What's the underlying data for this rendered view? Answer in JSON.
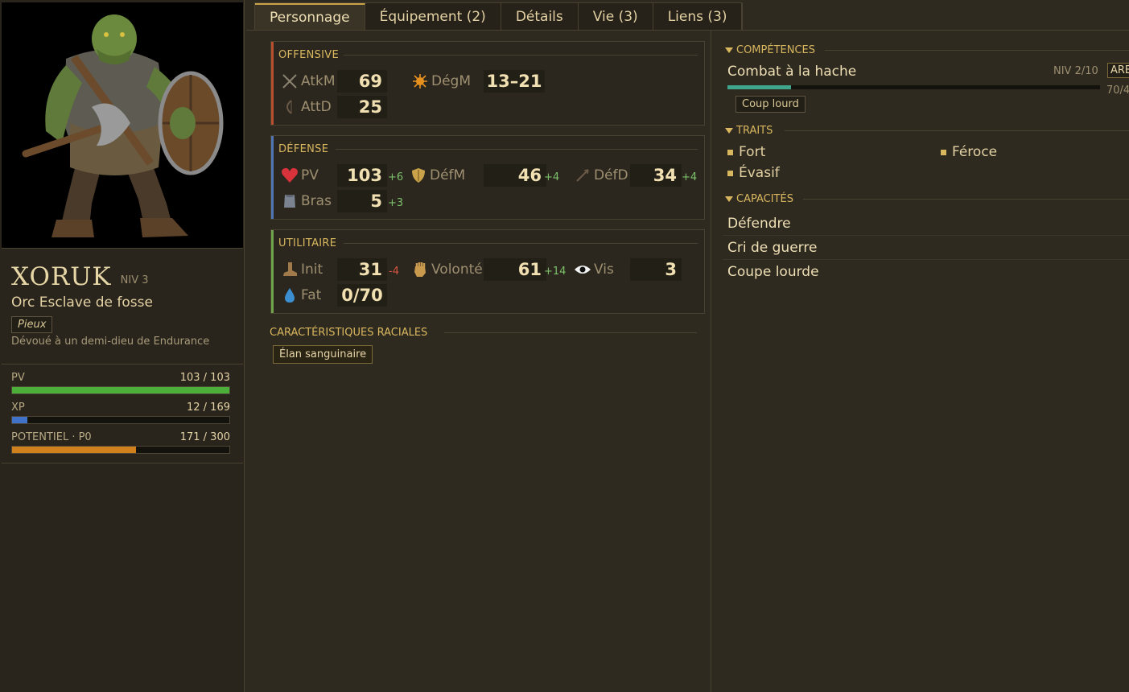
{
  "character": {
    "name": "XORUK",
    "level": "NIV 3",
    "class": "Orc Esclave de fosse",
    "trait_tag": "Pieux",
    "description": "Dévoué à un demi-dieu de Endurance"
  },
  "bars": [
    {
      "label": "PV",
      "value": "103 / 103",
      "fraction": 1.0,
      "color": "#4caf3a"
    },
    {
      "label": "XP",
      "value": "12 / 169",
      "fraction": 0.07,
      "color": "#3f72c8"
    },
    {
      "label": "POTENTIEL · P0",
      "value": "171 / 300",
      "fraction": 0.57,
      "color": "#d0801c"
    }
  ],
  "tabs": [
    {
      "label": "Personnage"
    },
    {
      "label": "Équipement (2)"
    },
    {
      "label": "Détails"
    },
    {
      "label": "Vie (3)"
    },
    {
      "label": "Liens (3)"
    }
  ],
  "offensive": {
    "title": "OFFENSIVE",
    "accent": "#b7502f",
    "stats": {
      "atkm": {
        "label": "AtkM",
        "value": "69",
        "icon": "crossed-swords-icon"
      },
      "degm": {
        "label": "DégM",
        "value": "13–21",
        "icon": "burst-icon"
      },
      "attd": {
        "label": "AttD",
        "value": "25",
        "icon": "bow-icon"
      }
    }
  },
  "defense": {
    "title": "DÉFENSE",
    "accent": "#4f75b3",
    "stats": {
      "pv": {
        "label": "PV",
        "value": "103",
        "mod": "+6",
        "icon": "heart-icon"
      },
      "defm": {
        "label": "DéfM",
        "value": "46",
        "mod": "+4",
        "icon": "shield-icon"
      },
      "defd": {
        "label": "DéfD",
        "value": "34",
        "mod": "+4",
        "icon": "arrow-icon"
      },
      "bras": {
        "label": "Bras",
        "value": "5",
        "mod": "+3",
        "icon": "armor-icon"
      }
    }
  },
  "utility": {
    "title": "UTILITAIRE",
    "accent": "#6fa44a",
    "stats": {
      "init": {
        "label": "Init",
        "value": "31",
        "mod": "-4",
        "icon": "boot-icon"
      },
      "volonte": {
        "label": "Volonté",
        "value": "61",
        "mod": "+14",
        "icon": "fist-icon"
      },
      "vis": {
        "label": "Vis",
        "value": "3",
        "icon": "eye-icon"
      },
      "fat": {
        "label": "Fat",
        "value": "0/70",
        "icon": "drop-icon"
      }
    }
  },
  "racial": {
    "title": "CARACTÉRISTIQUES RACIALES",
    "tags": [
      "Élan sanguinaire"
    ]
  },
  "competences": {
    "title": "COMPÉTENCES",
    "skill": {
      "name": "Combat à la hache",
      "level": "NIV 2/10",
      "tag": "ARE",
      "xp": "70/4",
      "fraction": 0.17,
      "chip": "Coup lourd"
    }
  },
  "traits": {
    "title": "TRAITS",
    "items": [
      "Fort",
      "Féroce",
      "Évasif"
    ]
  },
  "capacites": {
    "title": "CAPACITÉS",
    "items": [
      "Défendre",
      "Cri de guerre",
      "Coupe lourde"
    ]
  }
}
